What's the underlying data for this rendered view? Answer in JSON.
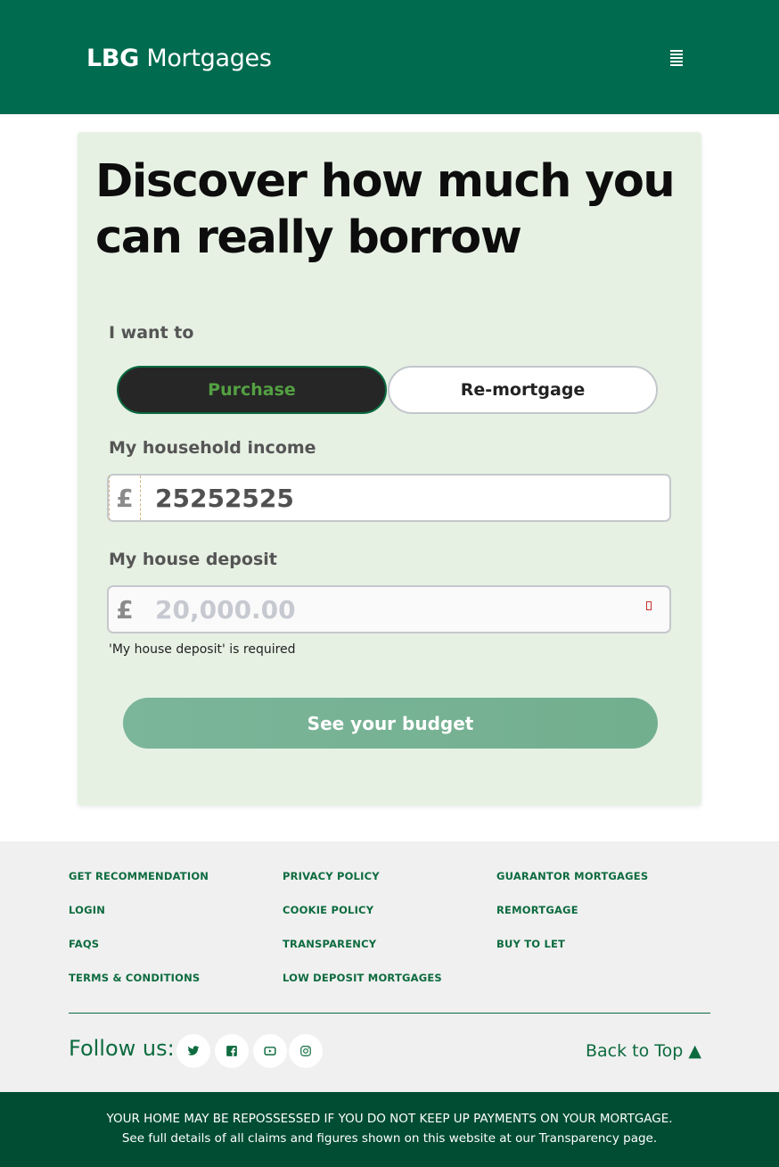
{
  "header": {
    "brand_bold": "LBG",
    "brand_rest": " Mortgages",
    "menu_icon": "hamburger-icon"
  },
  "form": {
    "headline": "Discover how much you can really borrow",
    "i_want_to_label": "I want to",
    "purchase_label": "Purchase",
    "remortgage_label": "Re-mortgage",
    "income_label": "My household income",
    "currency_symbol": "£",
    "income_value": "25252525",
    "deposit_label": "My house deposit",
    "deposit_placeholder": "20,000.00",
    "deposit_error": "'My house deposit' is required",
    "submit_label": "See your budget"
  },
  "footer": {
    "links_col1": [
      "GET RECOMMENDATION",
      "LOGIN",
      "FAQS",
      "TERMS & CONDITIONS"
    ],
    "links_col2": [
      "PRIVACY POLICY",
      "COOKIE POLICY",
      "TRANSPARENCY",
      "LOW DEPOSIT MORTGAGES"
    ],
    "links_col3": [
      "GUARANTOR MORTGAGES",
      "REMORTGAGE",
      "BUY TO LET"
    ],
    "follow_label": "Follow us:",
    "social_icons": [
      "twitter-icon",
      "facebook-icon",
      "youtube-icon",
      "instagram-icon"
    ],
    "back_to_top": "Back to Top ▲"
  },
  "disclaimer": {
    "line1": "YOUR HOME MAY BE REPOSSESSED IF YOU DO NOT KEEP UP PAYMENTS ON YOUR MORTGAGE.",
    "line2": "See full details of all claims and figures shown on this website at our Transparency page."
  },
  "colors": {
    "brand_green": "#006b4f",
    "card_bg": "#e6f1e4",
    "link_green": "#0d6b3f",
    "disclaimer_bg": "#004d33"
  }
}
